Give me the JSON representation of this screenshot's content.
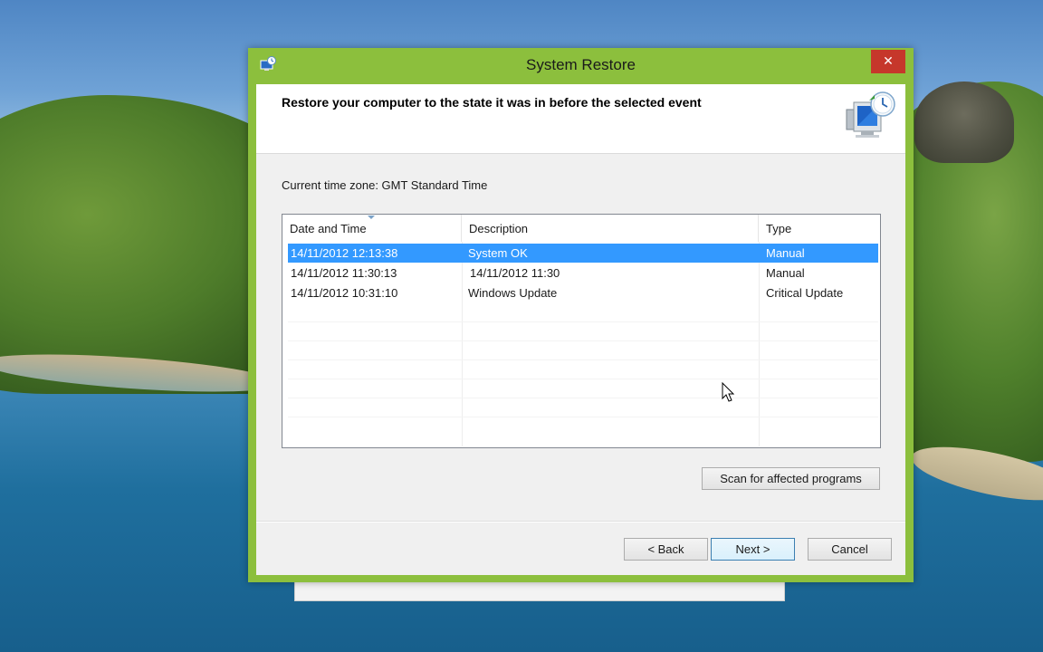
{
  "window": {
    "title": "System Restore",
    "close_glyph": "✕"
  },
  "header": {
    "text": "Restore your computer to the state it was in before the selected event",
    "icon": "system-restore-icon"
  },
  "timezone_label": "Current time zone: GMT Standard Time",
  "restore_points": {
    "columns": [
      "Date and Time",
      "Description",
      "Type"
    ],
    "rows": [
      {
        "date": "14/11/2012 12:13:38",
        "description": "System OK",
        "type": "Manual",
        "selected": true
      },
      {
        "date": "14/11/2012 11:30:13",
        "description": "14/11/2012 11:30",
        "type": "Manual",
        "selected": false
      },
      {
        "date": "14/11/2012 10:31:10",
        "description": "Windows Update",
        "type": "Critical Update",
        "selected": false
      }
    ]
  },
  "buttons": {
    "scan": "Scan for affected programs",
    "back": "< Back",
    "next": "Next >",
    "cancel": "Cancel"
  },
  "colors": {
    "window_frame": "#8cbf3d",
    "close_button": "#c6372b",
    "selection": "#3399ff"
  }
}
